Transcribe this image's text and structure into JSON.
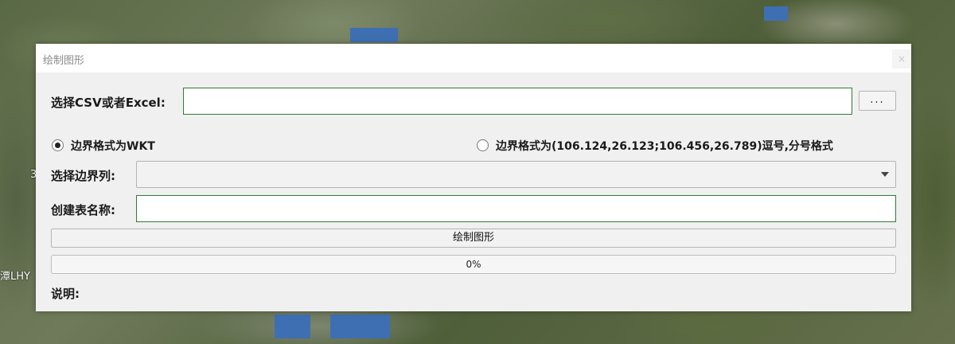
{
  "background": {
    "map_labels": [
      "3",
      "潭LHY"
    ]
  },
  "dialog": {
    "title": "绘制图形",
    "close_label": "×",
    "file": {
      "label": "选择CSV或者Excel:",
      "value": "",
      "browse_label": "..."
    },
    "format_options": [
      {
        "label": "边界格式为WKT",
        "checked": true
      },
      {
        "label": "边界格式为(106.124,26.123;106.456,26.789)逗号,分号格式",
        "checked": false
      }
    ],
    "boundary_column": {
      "label": "选择边界列:",
      "selected": ""
    },
    "table_name": {
      "label": "创建表名称:",
      "value": ""
    },
    "draw_button_label": "绘制图形",
    "progress": {
      "value": 0,
      "text": "0%"
    },
    "note_label": "说明:"
  },
  "colors": {
    "accent_border": "#2e7d32",
    "progress_fill": "#06b025"
  }
}
